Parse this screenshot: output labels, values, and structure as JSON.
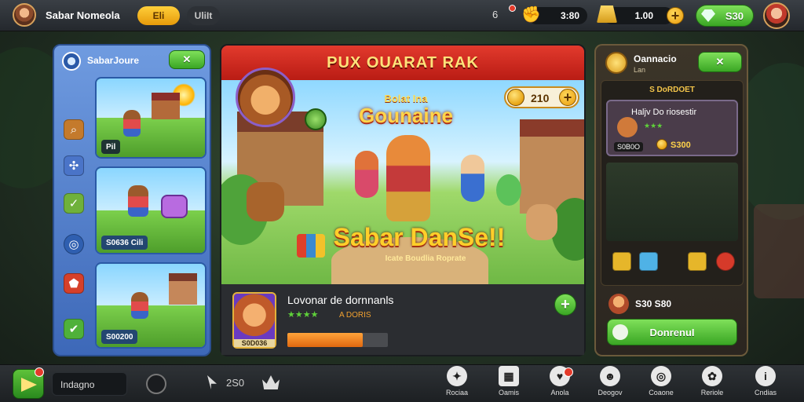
{
  "topbar": {
    "player_name": "Sabar Nomeola",
    "tab_active": "Eli",
    "tab_inactive": "UliIt",
    "level_icon_text": "6",
    "currency_1": "3:80",
    "currency_2": "1.00",
    "gems_label": "S30",
    "plus": "+"
  },
  "left_panel": {
    "title": "SabarJoure",
    "thumbs": [
      {
        "tag": "Pil"
      },
      {
        "tag": "S0636 Cili"
      },
      {
        "tag": "S00200"
      }
    ],
    "side_icons": [
      "search-icon",
      "puzzle-icon",
      "check-icon",
      "target-icon",
      "shield-icon",
      "checkmark-icon"
    ]
  },
  "center_panel": {
    "header_title": "PUX OUARAT RAK",
    "coin_counter": "210",
    "logo_line_1": "Gounaine",
    "logo_small": "Bolat Ina",
    "banner_title": "Sabar DanSe!!",
    "banner_subtitle": "Icate Boudlia Roprate",
    "quest_title": "Lovonar de dornnanls",
    "quest_stars": "★★★★",
    "quest_desc": "A DORIS",
    "quest_card_tag": "S0D036",
    "quest_progress": 0.75,
    "plus": "+"
  },
  "right_panel": {
    "title": "Oannacio",
    "subtitle": "Lan",
    "section_label": "S DoRDOET",
    "featured_title": "Haljv Do riosestir",
    "featured_stars": "★★★",
    "featured_tag": "S0B0O",
    "featured_price": "S300",
    "reward_price": "S30 S80",
    "cta_label": "DonrenuI"
  },
  "bottom_bar": {
    "search_text": "Indagno",
    "mid_label": "2S0",
    "nav": [
      {
        "label": "Rociaa",
        "icon": "star-icon"
      },
      {
        "label": "Oamis",
        "icon": "calendar-icon"
      },
      {
        "label": "Anola",
        "icon": "heart-icon"
      },
      {
        "label": "Deogov",
        "icon": "face-icon"
      },
      {
        "label": "Coaone",
        "icon": "target-icon"
      },
      {
        "label": "Reriole",
        "icon": "settings-icon"
      },
      {
        "label": "Cndias",
        "icon": "info-icon"
      }
    ]
  },
  "colors": {
    "accent_red": "#d92a1f",
    "accent_green": "#4cbf2f",
    "accent_gold": "#f3b81b",
    "panel_blue": "#4f7ed0"
  }
}
